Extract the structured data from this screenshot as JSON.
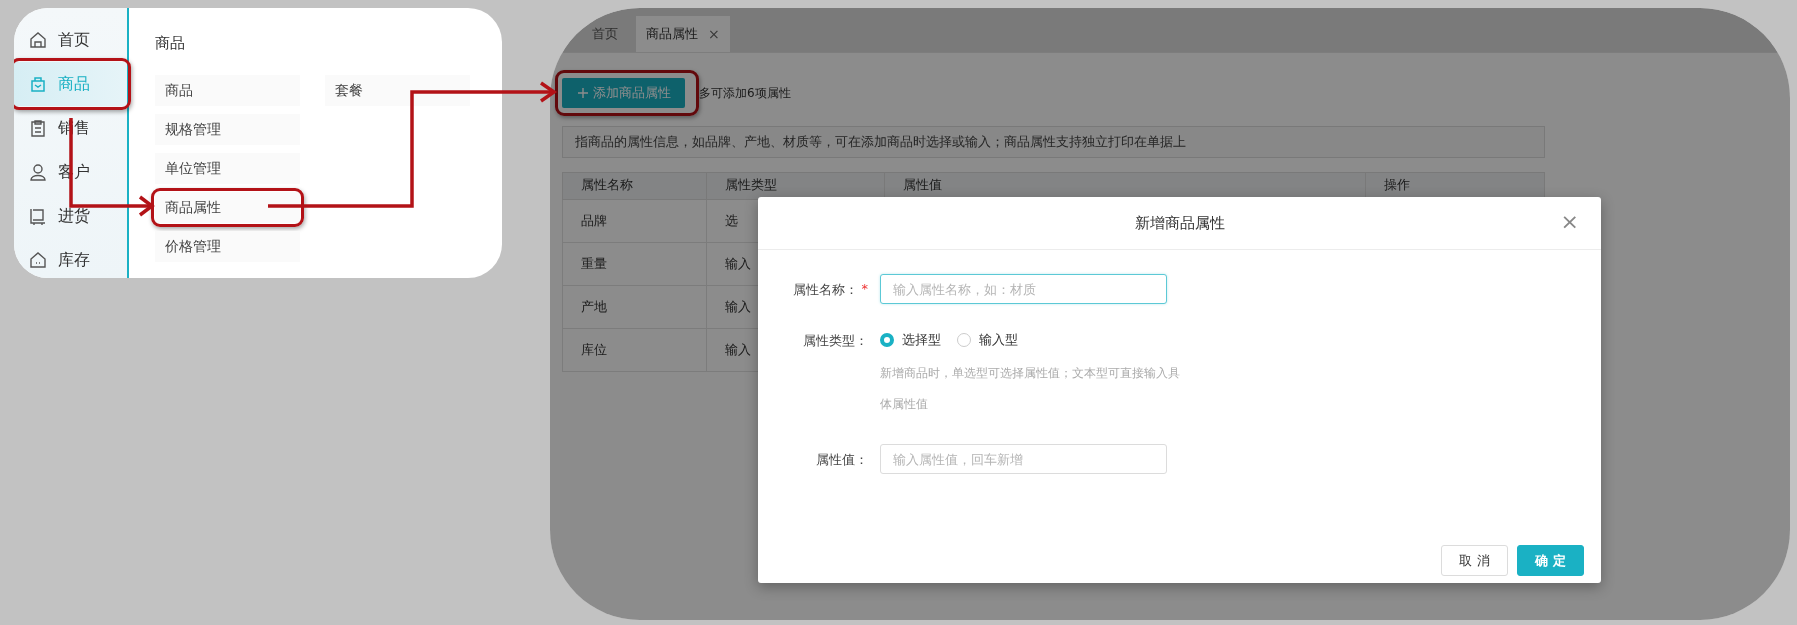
{
  "sidebar": {
    "items": [
      {
        "label": "首页",
        "selected": false,
        "callout": false
      },
      {
        "label": "商品",
        "selected": true,
        "callout": true
      },
      {
        "label": "销售",
        "selected": false,
        "callout": false
      },
      {
        "label": "客户",
        "selected": false,
        "callout": false
      },
      {
        "label": "进货",
        "selected": false,
        "callout": false
      },
      {
        "label": "库存",
        "selected": false,
        "callout": false
      }
    ]
  },
  "submenu": {
    "title": "商品",
    "columns": [
      [
        {
          "label": "商品",
          "callout": false
        },
        {
          "label": "规格管理",
          "callout": false
        },
        {
          "label": "单位管理",
          "callout": false
        },
        {
          "label": "商品属性",
          "callout": true
        },
        {
          "label": "价格管理",
          "callout": false
        }
      ],
      [
        {
          "label": "套餐",
          "callout": false
        }
      ]
    ]
  },
  "tabs": [
    {
      "label": "首页",
      "selected": false
    },
    {
      "label": "商品属性",
      "selected": true,
      "close": "×"
    }
  ],
  "toolbar": {
    "add_button": {
      "label": "添加商品属性",
      "callout": true
    },
    "note": "多可添加6项属性"
  },
  "info": "指商品的属性信息，如品牌、产地、材质等，可在添加商品时选择或输入；商品属性支持独立打印在单据上",
  "table": {
    "columns": [
      "属性名称",
      "属性类型",
      "属性值",
      "操作"
    ],
    "rows": [
      {
        "cells": [
          "品牌",
          "选"
        ]
      },
      {
        "cells": [
          "重量",
          "输入"
        ]
      },
      {
        "cells": [
          "产地",
          "输入"
        ]
      },
      {
        "cells": [
          "库位",
          "输入"
        ]
      }
    ]
  },
  "dialog": {
    "title": "新增商品属性",
    "close": "×",
    "fields": [
      {
        "kind": "text",
        "label": "属性名称：",
        "required_mark": "*",
        "placeholder": "输入属性名称，如：材质",
        "focused": true
      },
      {
        "kind": "radio",
        "label": "属性类型：",
        "options": [
          {
            "label": "选择型",
            "selected": true
          },
          {
            "label": "输入型",
            "selected": false
          }
        ],
        "help": "新增商品时，单选型可选择属性值；文本型可直接输入具体属性值"
      },
      {
        "kind": "text",
        "label": "属性值：",
        "placeholder": "输入属性值，回车新增",
        "focused": false
      }
    ],
    "buttons": [
      {
        "label": "取 消",
        "kind": "secondary"
      },
      {
        "label": "确 定",
        "kind": "primary"
      }
    ]
  }
}
